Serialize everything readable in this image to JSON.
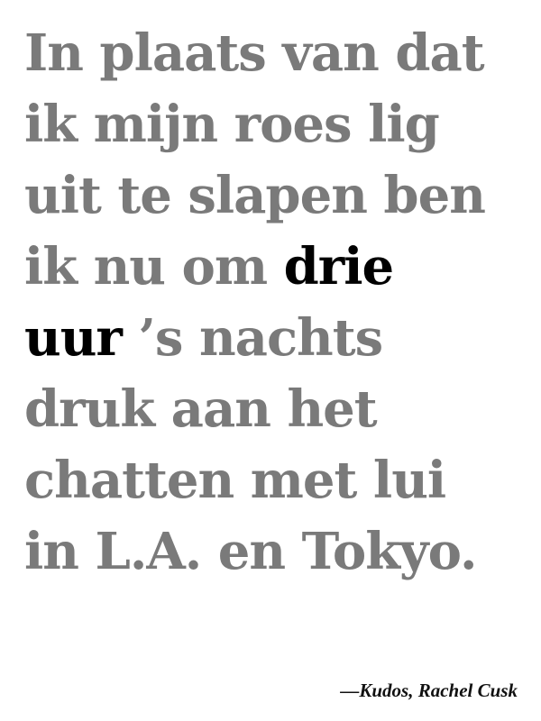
{
  "quote": {
    "line1": "In plaats van dat",
    "line2": "ik mijn roes lig",
    "line3": "uit te slapen ben",
    "line4_pre": "ik nu om ",
    "line4_highlight": "drie",
    "line5_highlight": "uur",
    "line5_post": " ’s nachts",
    "line6": "druk aan het",
    "line7": "chatten met lui",
    "line8": "in L.A. en Tokyo."
  },
  "attribution": "—Kudos, Rachel Cusk",
  "colors": {
    "text_gray": "#7a7a7a",
    "highlight": "#000000",
    "background": "#ffffff"
  }
}
